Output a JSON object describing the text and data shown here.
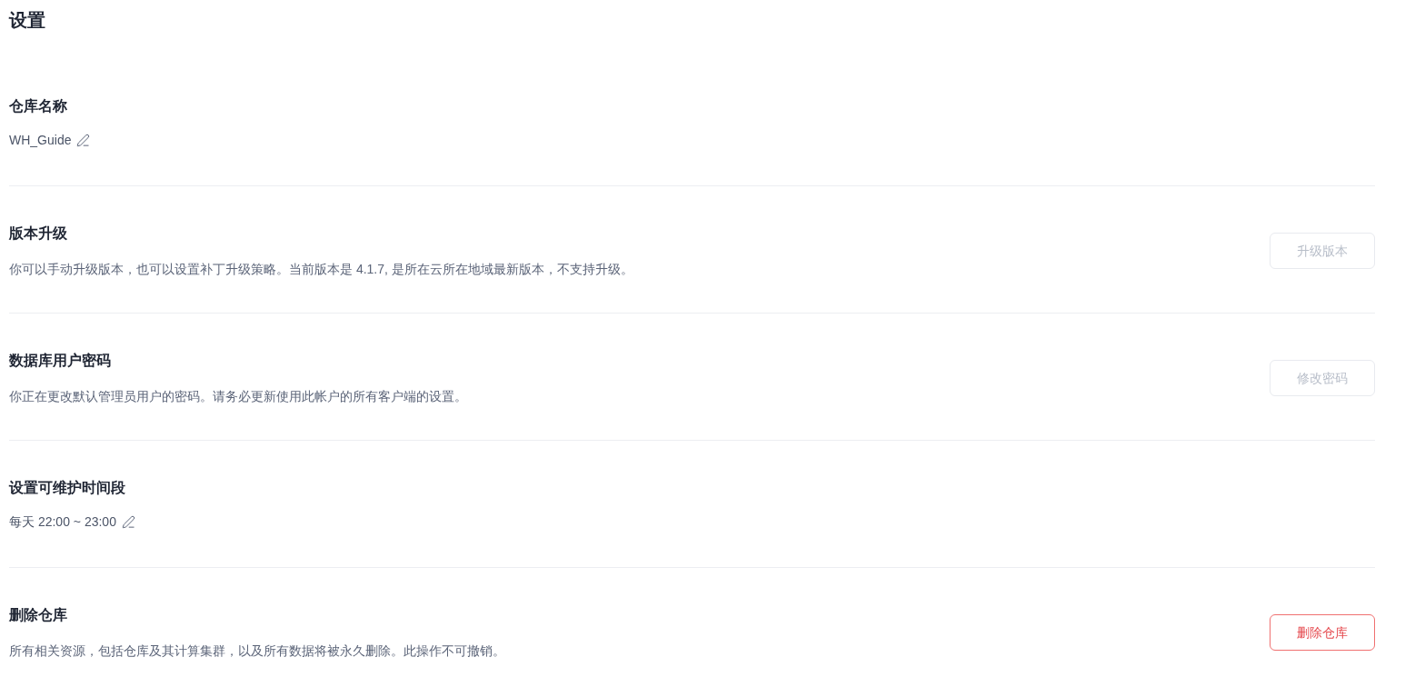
{
  "page": {
    "title": "设置"
  },
  "sections": [
    {
      "kind": "editable",
      "title": "仓库名称",
      "value": "WH_Guide"
    },
    {
      "kind": "action",
      "title": "版本升级",
      "description": "你可以手动升级版本，也可以设置补丁升级策略。当前版本是 4.1.7, 是所在云所在地域最新版本，不支持升级。",
      "button": {
        "label": "升级版本",
        "disabled": true,
        "danger": false
      }
    },
    {
      "kind": "action",
      "title": "数据库用户密码",
      "description": "你正在更改默认管理员用户的密码。请务必更新使用此帐户的所有客户端的设置。",
      "button": {
        "label": "修改密码",
        "disabled": true,
        "danger": false
      }
    },
    {
      "kind": "editable",
      "title": "设置可维护时间段",
      "value": "每天 22:00 ~ 23:00"
    },
    {
      "kind": "action",
      "title": "删除仓库",
      "description": "所有相关资源，包括仓库及其计算集群，以及所有数据将被永久删除。此操作不可撤销。",
      "button": {
        "label": "删除仓库",
        "disabled": false,
        "danger": true
      }
    }
  ]
}
